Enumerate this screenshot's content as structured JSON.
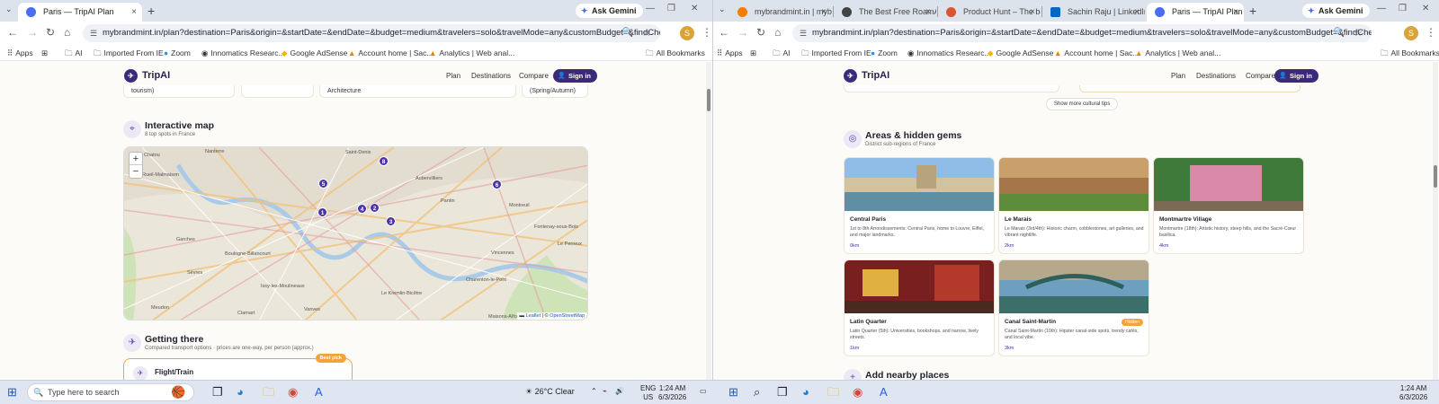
{
  "left_window": {
    "tab": {
      "title": "Paris — TripAI Plan",
      "close": "×"
    },
    "new_tab": "+",
    "gemini": "Ask Gemini",
    "window_controls": {
      "minimize": "—",
      "restore": "❐",
      "close": "✕"
    },
    "nav": {
      "back": "←",
      "forward": "→",
      "reload": "↻",
      "home": "⌂"
    },
    "url": "mybrandmint.in/plan?destination=Paris&origin=&startDate=&endDate=&budget=medium&travelers=solo&travelMode=any&customBudget=&findCheapest=",
    "profile_initial": "S",
    "menu": "⋮",
    "bookmarks": [
      "Apps",
      "AI",
      "Imported From IE",
      "Zoom",
      "Innomatics Researc...",
      "Google AdSense",
      "Account home | Sac...",
      "Analytics | Web anal..."
    ],
    "all_bookmarks": "All Bookmarks"
  },
  "right_window": {
    "tabs": [
      {
        "title": "mybrandmint.in | myb"
      },
      {
        "title": "The Best Free RoamAr"
      },
      {
        "title": "Product Hunt – The be"
      },
      {
        "title": "Sachin Raju | LinkedIn"
      },
      {
        "title": "Paris — TripAI Plan"
      }
    ],
    "close": "×",
    "new_tab": "+",
    "gemini": "Ask Gemini",
    "window_controls": {
      "minimize": "—",
      "restore": "❐",
      "close": "✕"
    },
    "nav": {
      "back": "←",
      "forward": "→",
      "reload": "↻",
      "home": "⌂"
    },
    "url": "mybrandmint.in/plan?destination=Paris&origin=&startDate=&endDate=&budget=medium&travelers=solo&travelMode=any&customBudget=&findCheapest=",
    "profile_initial": "S",
    "menu": "⋮",
    "bookmarks": [
      "Apps",
      "AI",
      "Imported From IE",
      "Zoom",
      "Innomatics Researc...",
      "Google AdSense",
      "Account home | Sac...",
      "Analytics | Web anal..."
    ],
    "all_bookmarks": "All Bookmarks"
  },
  "site": {
    "brand": "TripAI",
    "nav": [
      "Plan",
      "Destinations",
      "Compare"
    ],
    "signin": "Sign in"
  },
  "left_page": {
    "top_cards": [
      "tourism)",
      "",
      "Architecture",
      "(Spring/Autumn)"
    ],
    "map_section": {
      "title": "Interactive map",
      "subtitle": "8 top spots in France"
    },
    "map": {
      "zoom_in": "+",
      "zoom_out": "−",
      "attribution_leaflet": "Leaflet",
      "attribution_osm": "OpenStreetMap",
      "pins": [
        "8",
        "5",
        "6",
        "1",
        "4",
        "2",
        "3"
      ],
      "labels": [
        "Nanterre",
        "Chatou",
        "Rueil-Malmaison",
        "Garches",
        "Boulogne-Billancourt",
        "Sèvres",
        "Montreuil",
        "Fontenay-sous-Bois",
        "Vincennes",
        "Issy-les-Moulineaux",
        "Le Kremlin-Bicêtre",
        "Maisons-Alfort",
        "Charenton-le-Pont",
        "Saint-Denis",
        "Aubervilliers",
        "Pantin",
        "Le Perreux",
        "Clamart",
        "Meudon",
        "Vanves"
      ]
    },
    "transport_section": {
      "title": "Getting there",
      "subtitle": "Compared transport options · prices are one-way, per person (approx.)"
    },
    "transport_card": {
      "title": "Flight/Train",
      "badge": "Best pick"
    }
  },
  "right_page": {
    "show_more": "Show more cultural tips",
    "areas_section": {
      "title": "Areas & hidden gems",
      "subtitle": "District sub-regions of France"
    },
    "areas": [
      {
        "name": "Central Paris",
        "desc": "1st to 8th Arrondissements: Central Paris, home to Louvre, Eiffel, and major landmarks.",
        "km": "0km",
        "badge": ""
      },
      {
        "name": "Le Marais",
        "desc": "Le Marais (3rd/4th): Historic charm, cobblestones, art galleries, and vibrant nightlife.",
        "km": "2km",
        "badge": ""
      },
      {
        "name": "Montmartre Village",
        "desc": "Montmartre (18th): Artistic history, steep hills, and the Sacré-Cœur basilica.",
        "km": "4km",
        "badge": ""
      },
      {
        "name": "Latin Quarter",
        "desc": "Latin Quarter (5th): Universities, bookshops, and narrow, lively streets.",
        "km": "1km",
        "badge": ""
      },
      {
        "name": "Canal Saint-Martin",
        "desc": "Canal Saint-Martin (10th): Hipster canal-side spots, trendy cafés, and local vibe.",
        "km": "3km",
        "badge": "Hidden"
      }
    ],
    "next_section": {
      "title": "Add nearby places"
    }
  },
  "taskbar": {
    "search_placeholder": "Type here to search",
    "weather": "26°C  Clear",
    "lang_top": "ENG",
    "lang_bottom": "US",
    "time": "1:24 AM",
    "date": "6/3/2026"
  }
}
